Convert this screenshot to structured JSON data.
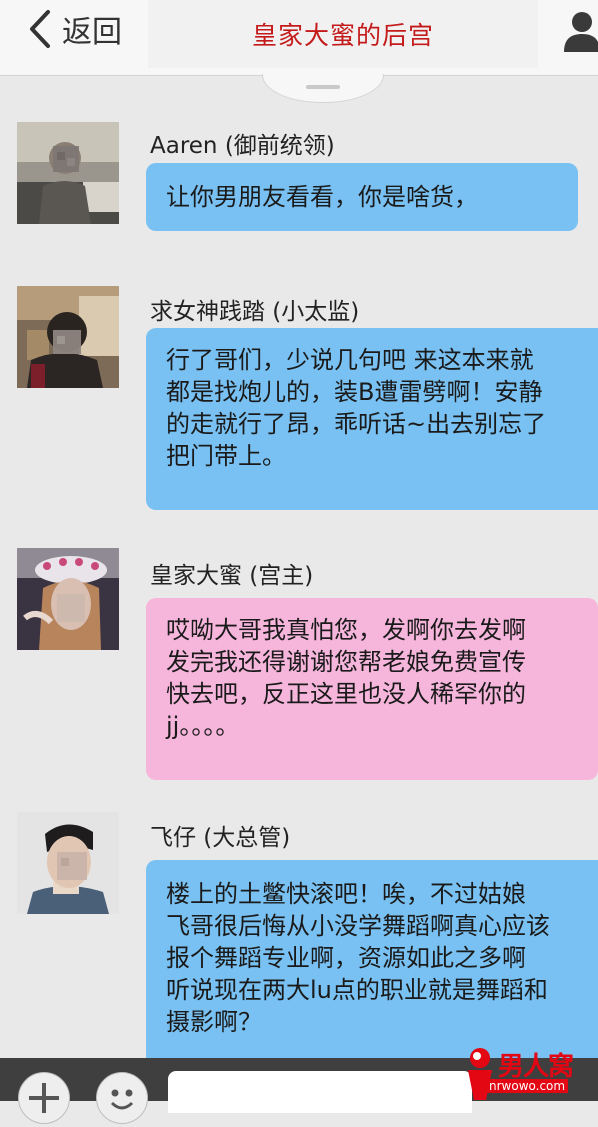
{
  "header": {
    "back_label": "返回",
    "title": "皇家大蜜的后宫",
    "title_color": "#c41a1a"
  },
  "messages": [
    {
      "sender": "Aaren (御前统领)",
      "bubble_color": "#79c1f2",
      "lines": [
        "让你男朋友看看，你是啥货，"
      ]
    },
    {
      "sender": "求女神践踏 (小太监)",
      "bubble_color": "#79c1f2",
      "lines": [
        "行了哥们，少说几句吧 来这本来就",
        "都是找炮儿的，装B遭雷劈啊！安静",
        "的走就行了昂，乖听话~出去别忘了",
        "把门带上。"
      ]
    },
    {
      "sender": "皇家大蜜 (宫主)",
      "bubble_color": "#f6b6dc",
      "lines": [
        "哎呦大哥我真怕您，发啊你去发啊",
        "发完我还得谢谢您帮老娘免费宣传",
        "快去吧，反正这里也没人稀罕你的",
        "jj。。。。"
      ]
    },
    {
      "sender": "飞仔 (大总管)",
      "bubble_color": "#79c1f2",
      "lines": [
        "楼上的土鳖快滚吧！唉，不过姑娘",
        "飞哥很后悔从小没学舞蹈啊真心应该",
        "报个舞蹈专业啊，资源如此之多啊",
        "听说现在两大lu点的职业就是舞蹈和",
        "摄影啊？"
      ]
    }
  ],
  "watermark": {
    "name": "男人窝",
    "url": "nrwowo.com"
  },
  "icons": {
    "back": "chevron-left-icon",
    "profile": "person-icon",
    "add": "plus-icon",
    "emoji": "smiley-icon"
  }
}
